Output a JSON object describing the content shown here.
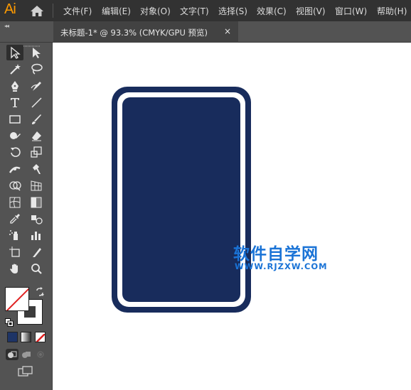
{
  "app": {
    "logo": "Ai"
  },
  "menu": [
    {
      "id": "file",
      "label": "文件(F)"
    },
    {
      "id": "edit",
      "label": "编辑(E)"
    },
    {
      "id": "object",
      "label": "对象(O)"
    },
    {
      "id": "type",
      "label": "文字(T)"
    },
    {
      "id": "select",
      "label": "选择(S)"
    },
    {
      "id": "effect",
      "label": "效果(C)"
    },
    {
      "id": "view",
      "label": "视图(V)"
    },
    {
      "id": "window",
      "label": "窗口(W)"
    },
    {
      "id": "help",
      "label": "帮助(H)"
    }
  ],
  "tabs": {
    "collapse": "◂◂",
    "document": {
      "title": "未标题-1* @ 93.3% (CMYK/GPU 预览)",
      "close": "×"
    }
  },
  "toolbar": {
    "tools": [
      [
        "selection-tool-icon",
        "direct-selection-tool-icon"
      ],
      [
        "magic-wand-tool-icon",
        "lasso-tool-icon"
      ],
      [
        "pen-tool-icon",
        "curvature-tool-icon"
      ],
      [
        "type-tool-icon",
        "line-segment-tool-icon"
      ],
      [
        "rectangle-tool-icon",
        "paintbrush-tool-icon"
      ],
      [
        "shaper-tool-icon",
        "eraser-tool-icon"
      ],
      [
        "rotate-tool-icon",
        "scale-tool-icon"
      ],
      [
        "width-tool-icon",
        "puppet-warp-tool-icon"
      ],
      [
        "shape-builder-tool-icon",
        "perspective-grid-tool-icon"
      ],
      [
        "mesh-tool-icon",
        "gradient-tool-icon"
      ],
      [
        "eyedropper-tool-icon",
        "blend-tool-icon"
      ],
      [
        "symbol-sprayer-tool-icon",
        "column-graph-tool-icon"
      ],
      [
        "artboard-tool-icon",
        "slice-tool-icon"
      ],
      [
        "hand-tool-icon",
        "zoom-tool-icon"
      ]
    ],
    "active_tool": "selection-tool-icon",
    "fill": "none",
    "stroke_color": "#3c3c3c",
    "color_modes": [
      "color",
      "gradient",
      "none"
    ],
    "draw_modes": [
      "draw-normal",
      "draw-behind",
      "draw-inside"
    ]
  },
  "artwork": {
    "outer_color": "#182c5c",
    "gap_color": "#ffffff",
    "inner_color": "#182c5c"
  },
  "watermark": {
    "title": "软件自学网",
    "url": "WWW.RJZXW.COM",
    "color": "#1a73d6"
  }
}
